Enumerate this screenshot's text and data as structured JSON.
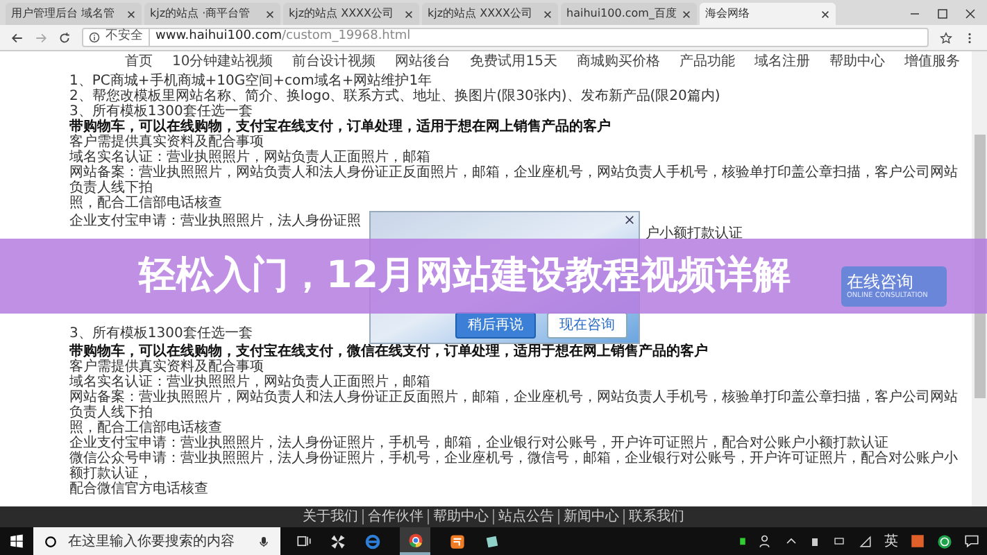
{
  "browser": {
    "tabs": [
      {
        "label": "用户管理后台 域名管",
        "selected": false
      },
      {
        "label": "kjz的站点 ·商平台管",
        "selected": false
      },
      {
        "label": "kjz的站点 XXXX公司",
        "selected": false
      },
      {
        "label": "kjz的站点 XXXX公司",
        "selected": false
      },
      {
        "label": "haihui100.com_百度",
        "selected": false
      },
      {
        "label": "海会网络",
        "selected": true
      }
    ],
    "security": "不安全",
    "url_host": "www.haihui100.com",
    "url_path": "/custom_19968.html"
  },
  "nav": [
    "首页",
    "10分钟建站视频",
    "前台设计视频",
    "网站後台",
    "免费试用15天",
    "商城购买价格",
    "产品功能",
    "域名注册",
    "帮助中心",
    "增值服务"
  ],
  "top_lines": [
    {
      "text": "1、PC商城+手机商城+10G空间+com域名+网站维护1年",
      "bold": false
    },
    {
      "text": "2、帮您改模板里网站名称、简介、换logo、联系方式、地址、换图片(限30张内)、发布新产品(限20篇内)",
      "bold": false
    },
    {
      "text": "3、所有模板1300套任选一套",
      "bold": false
    },
    {
      "text": "带购物车，可以在线购物，支付宝在线支付，订单处理，适用于想在网上销售产品的客户",
      "bold": true
    },
    {
      "text": "客户需提供真实资料及配合事项",
      "bold": false
    },
    {
      "text": "域名实名认证：营业执照照片，网站负责人正面照片，邮箱",
      "bold": false
    },
    {
      "text": "网站备案：营业执照照片，网站负责人和法人身份证正反面照片，邮箱，企业座机号，网站负责人手机号，核验单打印盖公章扫描，客户公司网站负责人线下拍",
      "bold": false
    },
    {
      "text": "照，配合工信部电话核查",
      "bold": false
    }
  ],
  "middle": {
    "left_top": "企业支付宝申请：营业执照照片，法人身份证照",
    "right_top": "户小额打款认证",
    "left_bottom": "3、所有模板1300套任选一套"
  },
  "popup": {
    "buttons": [
      {
        "label": "稍后再说",
        "selected": true
      },
      {
        "label": "现在咨询",
        "selected": false
      }
    ]
  },
  "bottom_lines": [
    {
      "text": "带购物车，可以在线购物，支付宝在线支付，微信在线支付，订单处理，适用于想在网上销售产品的客户",
      "bold": true
    },
    {
      "text": "客户需提供真实资料及配合事项",
      "bold": false
    },
    {
      "text": "域名实名认证：营业执照照片，网站负责人正面照片，邮箱",
      "bold": false
    },
    {
      "text": "网站备案：营业执照照片，网站负责人和法人身份证正反面照片，邮箱，企业座机号，网站负责人手机号，核验单打印盖公章扫描，客户公司网站负责人线下拍",
      "bold": false
    },
    {
      "text": "照，配合工信部电话核查",
      "bold": false
    },
    {
      "text": "企业支付宝申请：营业执照照片，法人身份证照片，手机号，邮箱，企业银行对公账号，开户许可证照片，配合对公账户小额打款认证",
      "bold": false
    },
    {
      "text": "微信公众号申请：营业执照照片，法人身份证照片，手机号，企业座机号，微信号，邮箱，企业银行对公账号，开户许可证照片，配合对公账户小额打款认证，",
      "bold": false
    },
    {
      "text": "配合微信官方电话核查",
      "bold": false
    }
  ],
  "banner": {
    "title": "轻松入门，12月网站建设教程视频详解"
  },
  "consult": {
    "label": "在线咨询",
    "sublabel": "ONLINE CONSULTATION"
  },
  "footer": [
    "关于我们",
    "合作伙伴",
    "帮助中心",
    "站点公告",
    "新闻中心",
    "联系我们"
  ],
  "taskbar": {
    "search_placeholder": "在这里输入你要搜索的内容",
    "ime": "英"
  }
}
